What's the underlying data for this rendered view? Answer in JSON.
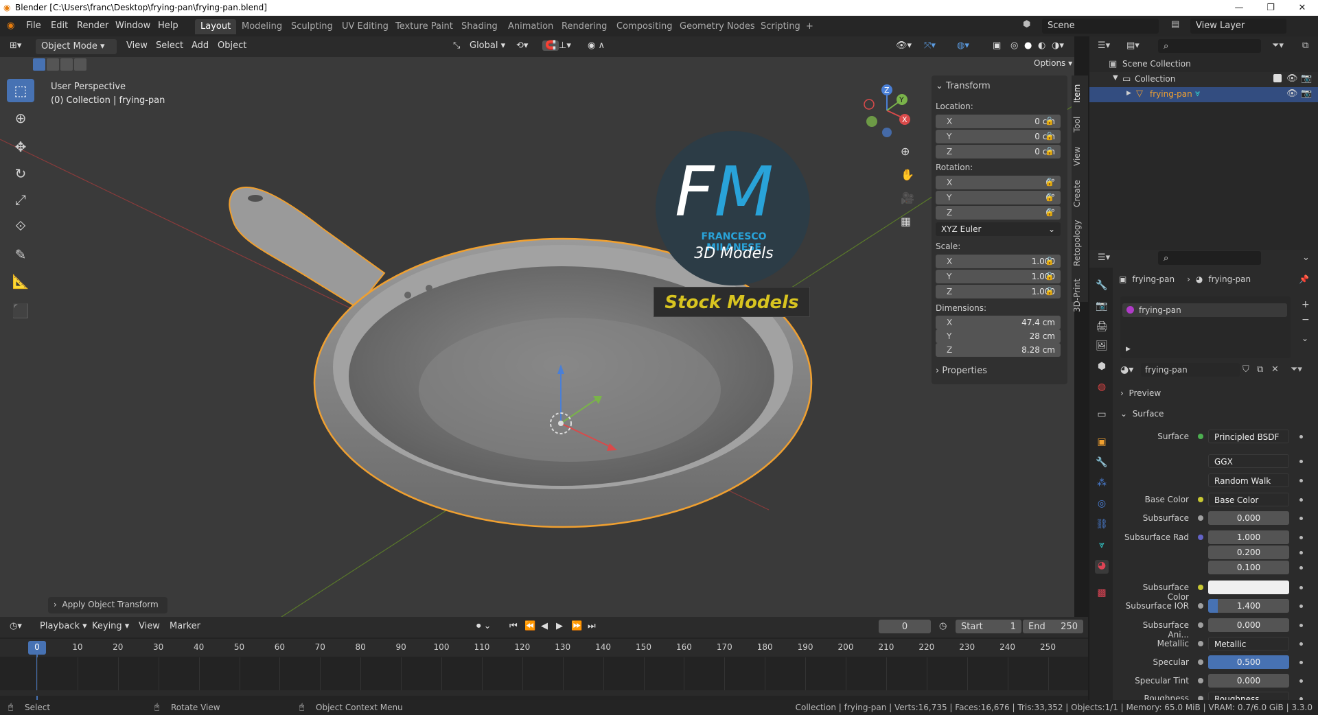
{
  "window": {
    "title": "Blender [C:\\Users\\franc\\Desktop\\frying-pan\\frying-pan.blend]"
  },
  "menu": [
    "File",
    "Edit",
    "Render",
    "Window",
    "Help"
  ],
  "workspaces": [
    "Layout",
    "Modeling",
    "Sculpting",
    "UV Editing",
    "Texture Paint",
    "Shading",
    "Animation",
    "Rendering",
    "Compositing",
    "Geometry Nodes",
    "Scripting",
    "+"
  ],
  "scene": {
    "name": "Scene",
    "view_layer": "View Layer"
  },
  "viewport": {
    "mode": "Object Mode",
    "menus": [
      "View",
      "Select",
      "Add",
      "Object"
    ],
    "orientation": "Global",
    "options": "Options",
    "info_line1": "User Perspective",
    "info_line2": "(0) Collection | frying-pan",
    "last_op": "Apply Object Transform",
    "logo": {
      "initials": "FM",
      "author": "FRANCESCO MILANESE",
      "subtitle": "3D Models",
      "banner": "Stock Models"
    },
    "gizmo": {
      "x": "X",
      "y": "Y",
      "z": "Z"
    }
  },
  "transform_panel": {
    "header": "Transform",
    "location_label": "Location:",
    "location": [
      {
        "axis": "X",
        "value": "0 cm"
      },
      {
        "axis": "Y",
        "value": "0 cm"
      },
      {
        "axis": "Z",
        "value": "0 cm"
      }
    ],
    "rotation_label": "Rotation:",
    "rotation": [
      {
        "axis": "X",
        "value": "0°"
      },
      {
        "axis": "Y",
        "value": "0°"
      },
      {
        "axis": "Z",
        "value": "0°"
      }
    ],
    "rotation_mode": "XYZ Euler",
    "scale_label": "Scale:",
    "scale": [
      {
        "axis": "X",
        "value": "1.000"
      },
      {
        "axis": "Y",
        "value": "1.000"
      },
      {
        "axis": "Z",
        "value": "1.000"
      }
    ],
    "dimensions_label": "Dimensions:",
    "dimensions": [
      {
        "axis": "X",
        "value": "47.4 cm"
      },
      {
        "axis": "Y",
        "value": "28 cm"
      },
      {
        "axis": "Z",
        "value": "8.28 cm"
      }
    ],
    "properties": "Properties"
  },
  "sidebar_tabs": [
    "Item",
    "Tool",
    "View",
    "Create",
    "Retopology",
    "3D-Print"
  ],
  "outliner": {
    "scene_collection": "Scene Collection",
    "collection": "Collection",
    "object": "frying-pan"
  },
  "properties": {
    "breadcrumb_object": "frying-pan",
    "breadcrumb_material": "frying-pan",
    "slot": "frying-pan",
    "material": "frying-pan",
    "preview": "Preview",
    "surface_section": "Surface",
    "rows": [
      {
        "label": "Surface",
        "value": "Principled BSDF",
        "dot": "#4caf50",
        "style": "dark"
      },
      {
        "label": "",
        "value": "GGX",
        "dot": "",
        "style": "dark"
      },
      {
        "label": "",
        "value": "Random Walk",
        "dot": "",
        "style": "dark"
      },
      {
        "label": "Base Color",
        "value": "Base Color",
        "dot": "#c8c832",
        "style": "dark"
      },
      {
        "label": "Subsurface",
        "value": "0.000",
        "dot": "#a0a0a0",
        "style": "num"
      },
      {
        "label": "Subsurface Rad",
        "value": "1.000",
        "dot": "#6363c7",
        "style": "num"
      },
      {
        "label": "",
        "value": "0.200",
        "dot": "",
        "style": "num"
      },
      {
        "label": "",
        "value": "0.100",
        "dot": "",
        "style": "num"
      },
      {
        "label": "Subsurface Color",
        "value": "",
        "dot": "#c8c832",
        "style": "white"
      },
      {
        "label": "Subsurface IOR",
        "value": "1.400",
        "dot": "#a0a0a0",
        "style": "ior"
      },
      {
        "label": "Subsurface Ani...",
        "value": "0.000",
        "dot": "#a0a0a0",
        "style": "num"
      },
      {
        "label": "Metallic",
        "value": "Metallic",
        "dot": "#a0a0a0",
        "style": "dark"
      },
      {
        "label": "Specular",
        "value": "0.500",
        "dot": "#a0a0a0",
        "style": "blue"
      },
      {
        "label": "Specular Tint",
        "value": "0.000",
        "dot": "#a0a0a0",
        "style": "num"
      },
      {
        "label": "Roughness",
        "value": "Roughness",
        "dot": "#a0a0a0",
        "style": "dark"
      }
    ]
  },
  "timeline": {
    "menus": [
      "Playback",
      "Keying",
      "View",
      "Marker"
    ],
    "current_frame": "0",
    "start_label": "Start",
    "start": "1",
    "end_label": "End",
    "end": "250",
    "ticks": [
      "0",
      "10",
      "20",
      "30",
      "40",
      "50",
      "60",
      "70",
      "80",
      "90",
      "100",
      "110",
      "120",
      "130",
      "140",
      "150",
      "160",
      "170",
      "180",
      "190",
      "200",
      "210",
      "220",
      "230",
      "240",
      "250"
    ]
  },
  "status": {
    "select": "Select",
    "rotate": "Rotate View",
    "context": "Object Context Menu",
    "stats": "Collection | frying-pan | Verts:16,735 | Faces:16,676 | Tris:33,352 | Objects:1/1 | Memory: 65.0 MiB | VRAM: 0.7/6.0 GiB | 3.3.0"
  }
}
